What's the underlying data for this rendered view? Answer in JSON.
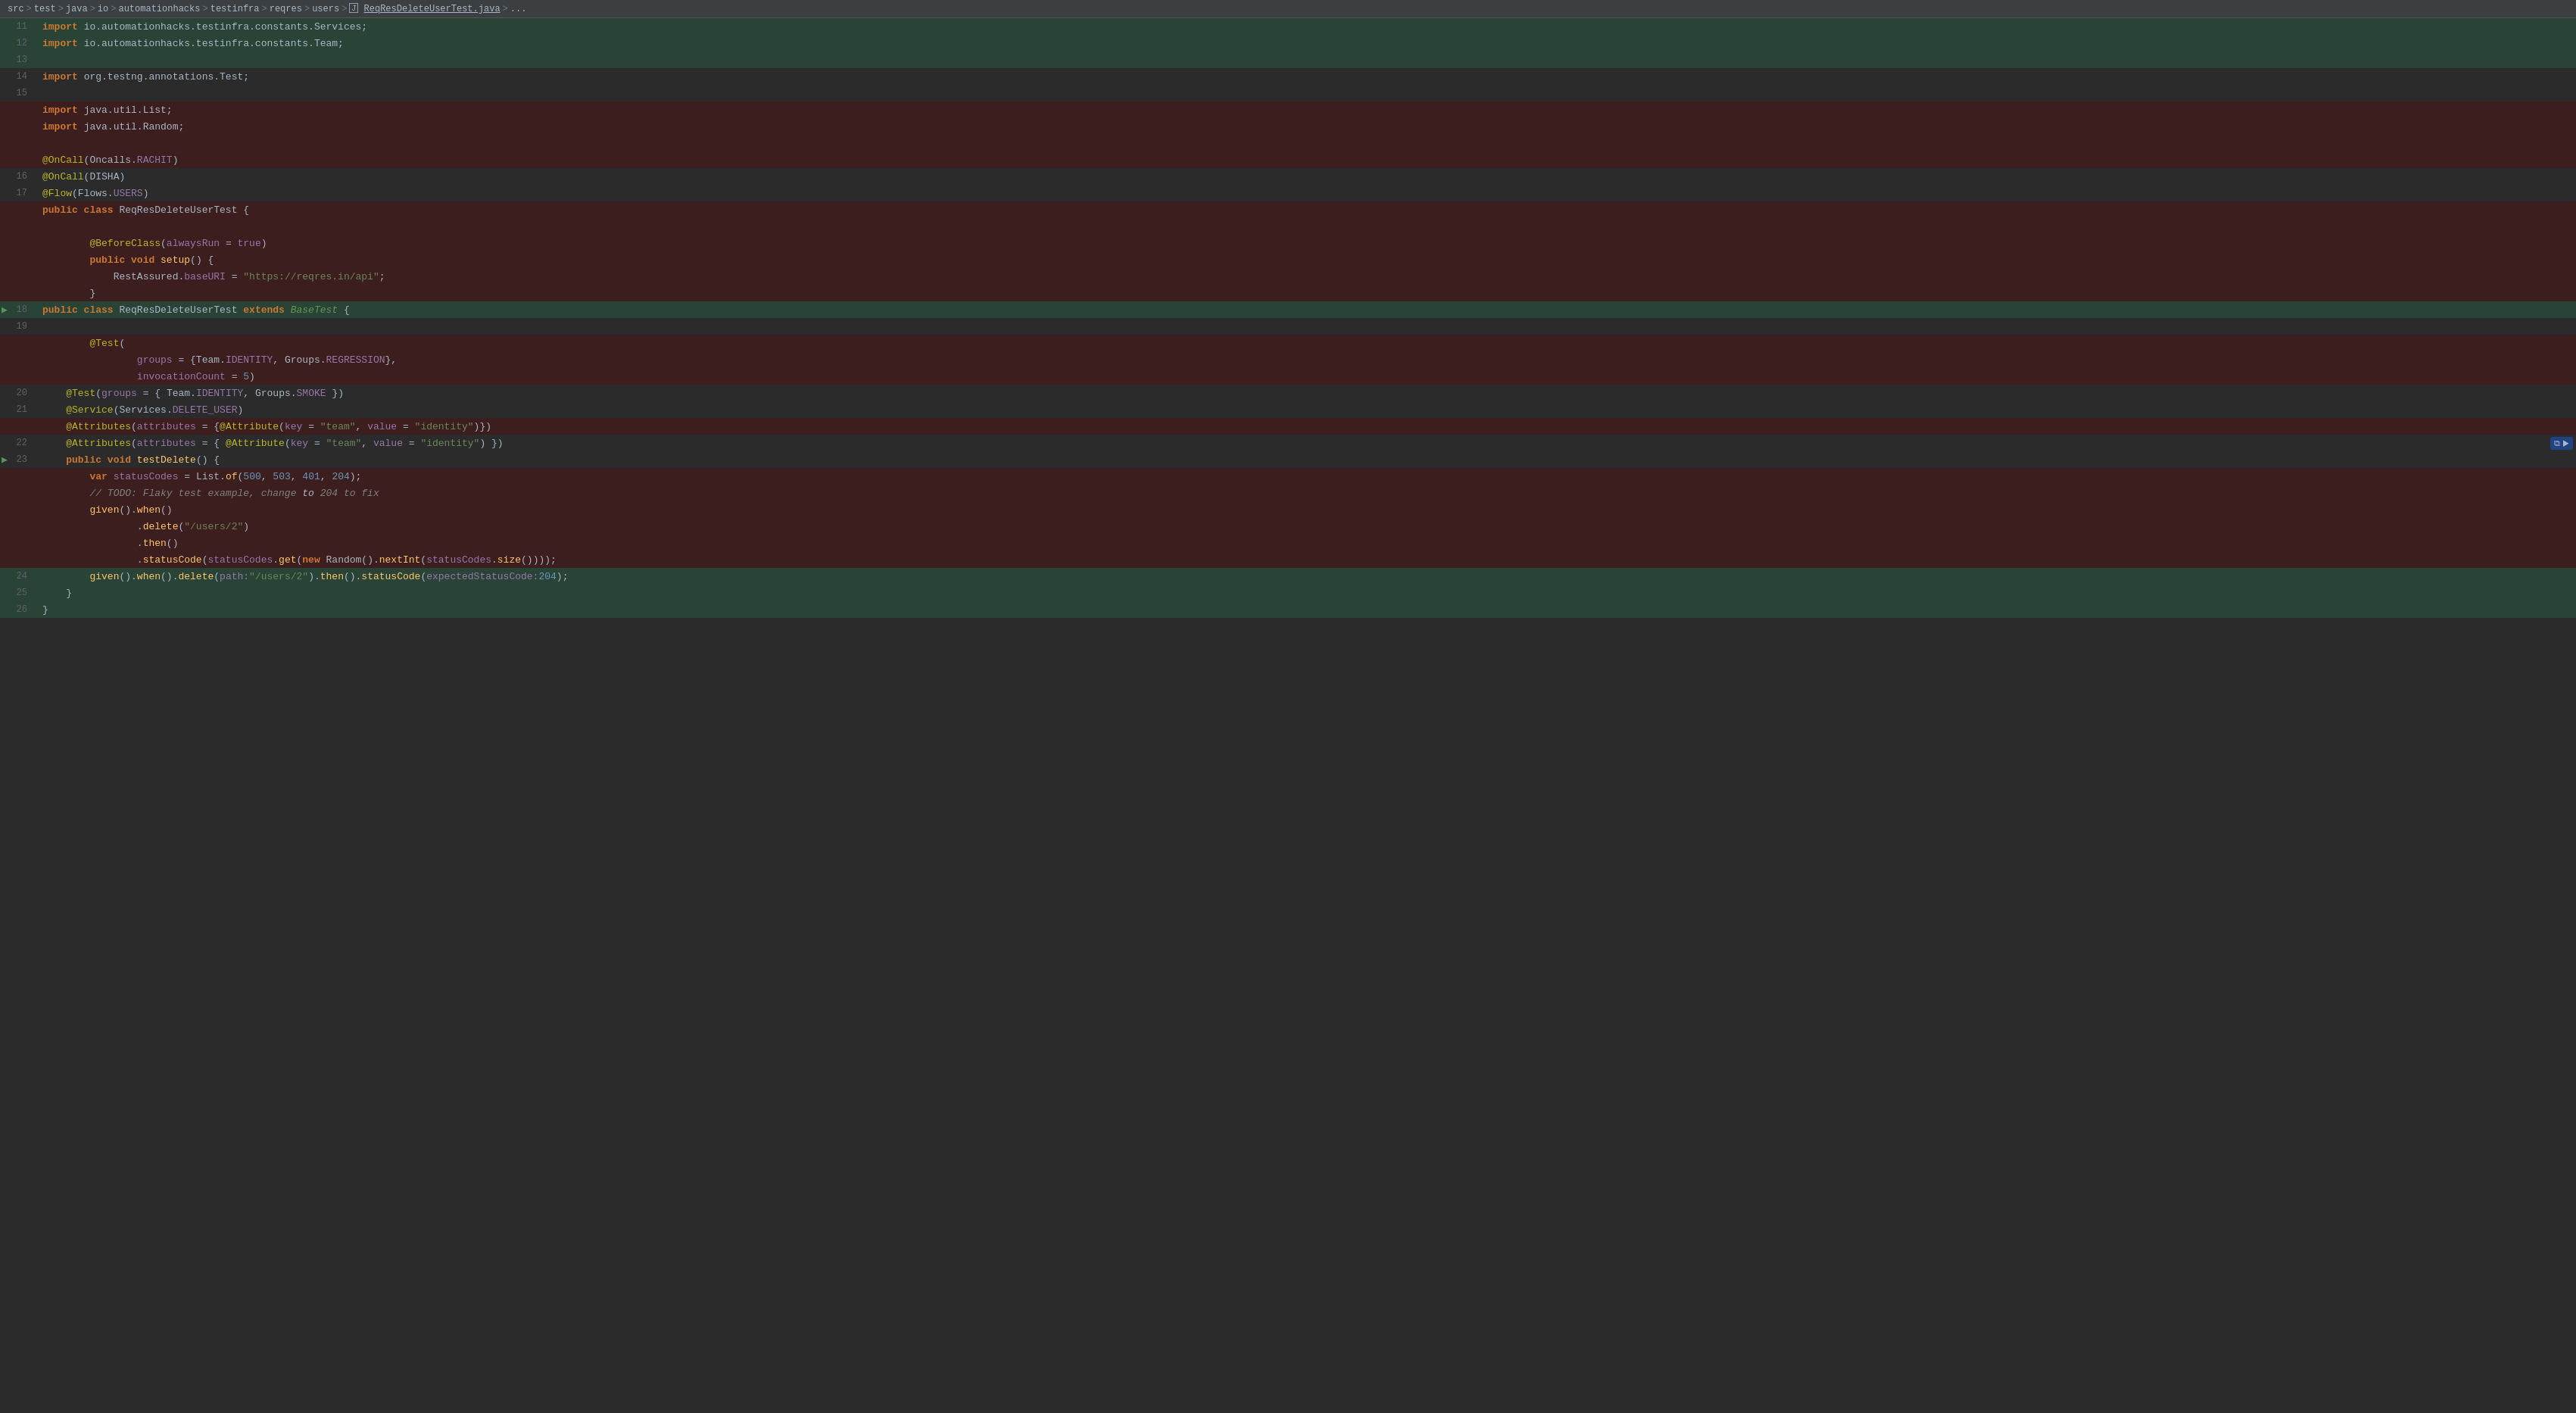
{
  "breadcrumb": {
    "parts": [
      "src",
      "test",
      "java",
      "io",
      "automationhacks",
      "testinfra",
      "reqres",
      "users"
    ],
    "file": "ReqResDeleteUserTest.java",
    "ellipsis": "..."
  },
  "toolbar": {
    "copy_label": "⧉"
  },
  "lines": [
    {
      "num": 11,
      "diff": "green",
      "content": "import_green_11"
    },
    {
      "num": 12,
      "diff": "green",
      "content": "import_green_12"
    },
    {
      "num": 13,
      "diff": "green",
      "content": "empty"
    },
    {
      "num": 14,
      "diff": "none",
      "content": "import_testng"
    },
    {
      "num": 15,
      "diff": "none",
      "content": "empty"
    },
    {
      "num": -1,
      "diff": "red",
      "content": "import_list"
    },
    {
      "num": -1,
      "diff": "red",
      "content": "import_random"
    },
    {
      "num": -1,
      "diff": "red",
      "content": "empty"
    },
    {
      "num": -1,
      "diff": "red",
      "content": "oncall_rachit"
    },
    {
      "num": 16,
      "diff": "none",
      "content": "oncall_disha"
    },
    {
      "num": 17,
      "diff": "none",
      "content": "flow_users"
    },
    {
      "num": -1,
      "diff": "red",
      "content": "public_class_old"
    },
    {
      "num": -1,
      "diff": "red",
      "content": "empty"
    },
    {
      "num": -1,
      "diff": "red",
      "content": "before_class"
    },
    {
      "num": -1,
      "diff": "red",
      "content": "public_void_setup"
    },
    {
      "num": -1,
      "diff": "red",
      "content": "restassured_base"
    },
    {
      "num": -1,
      "diff": "red",
      "content": "close_brace_inner"
    },
    {
      "num": 18,
      "diff": "green",
      "content": "public_class_new",
      "arrow": true
    },
    {
      "num": 19,
      "diff": "none",
      "content": "empty"
    },
    {
      "num": -1,
      "diff": "red",
      "content": "at_test_open"
    },
    {
      "num": -1,
      "diff": "red",
      "content": "groups_regression"
    },
    {
      "num": -1,
      "diff": "red",
      "content": "invocation_count"
    },
    {
      "num": 20,
      "diff": "none",
      "content": "at_test_smoke"
    },
    {
      "num": 21,
      "diff": "none",
      "content": "at_service"
    },
    {
      "num": -1,
      "diff": "red",
      "content": "at_attributes_old"
    },
    {
      "num": 22,
      "diff": "none",
      "content": "at_attributes_new",
      "copy": true
    },
    {
      "num": 23,
      "diff": "none",
      "content": "public_void_test",
      "arrow": true
    },
    {
      "num": -1,
      "diff": "red",
      "content": "var_status_codes"
    },
    {
      "num": -1,
      "diff": "red",
      "content": "comment_todo"
    },
    {
      "num": -1,
      "diff": "red",
      "content": "given_when"
    },
    {
      "num": -1,
      "diff": "red",
      "content": "dot_delete"
    },
    {
      "num": -1,
      "diff": "red",
      "content": "dot_then"
    },
    {
      "num": -1,
      "diff": "red",
      "content": "dot_status_code"
    },
    {
      "num": 24,
      "diff": "green",
      "content": "given_inline"
    },
    {
      "num": 25,
      "diff": "green",
      "content": "close_brace_method"
    },
    {
      "num": 26,
      "diff": "green",
      "content": "close_brace_class"
    }
  ]
}
